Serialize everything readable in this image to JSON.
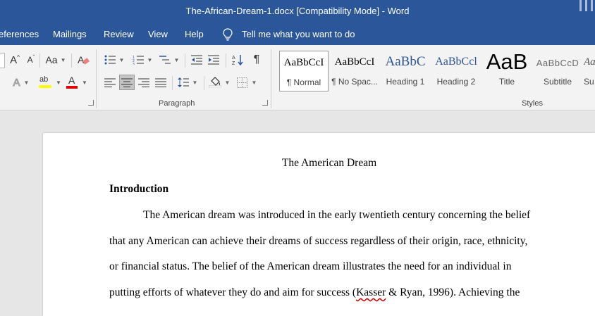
{
  "window": {
    "title": "The-African-Dream-1.docx  [Compatibility Mode]  -  Word"
  },
  "tabs": [
    {
      "label": "eferences"
    },
    {
      "label": "Mailings"
    },
    {
      "label": "Review"
    },
    {
      "label": "View"
    },
    {
      "label": "Help"
    }
  ],
  "tell_me": {
    "text": "Tell me what you want to do",
    "icon": "lightbulb-icon"
  },
  "ribbon": {
    "font_group": {
      "change_case": "Aa",
      "grow": "A",
      "shrink": "A",
      "font_color_letter": "A",
      "highlight_letters": "ab",
      "text_effects_letter": "A"
    },
    "paragraph_group": {
      "label": "Paragraph"
    },
    "styles_group": {
      "label": "Styles",
      "items": [
        {
          "sample": "AaBbCcI",
          "name": "¶ Normal"
        },
        {
          "sample": "AaBbCcI",
          "name": "¶ No Spac..."
        },
        {
          "sample": "AaBbC",
          "name": "Heading 1"
        },
        {
          "sample": "AaBbCcl",
          "name": "Heading 2"
        },
        {
          "sample": "AaB",
          "name": "Title"
        },
        {
          "sample": "AaBbCcD",
          "name": "Subtitle"
        },
        {
          "sample": "Aa",
          "name": "Su"
        }
      ]
    },
    "colors": {
      "accent": "#2b579a",
      "font_color": "#e00000",
      "highlight": "#ffff00",
      "heading_blue": "#2f5496"
    }
  },
  "document": {
    "title": "The American Dream",
    "heading": "Introduction",
    "lines": [
      "The American dream was introduced in the early twentieth century concerning the belief",
      "that any American can achieve their dreams of success regardless of their origin, race, ethnicity,",
      "or financial status. The belief of the American dream illustrates the need for an individual in"
    ],
    "last_line": {
      "before": "putting efforts of whatever they do and aim for success (",
      "misspelled": "Kasser",
      "after": " & Ryan, 1996). Achieving the"
    }
  }
}
